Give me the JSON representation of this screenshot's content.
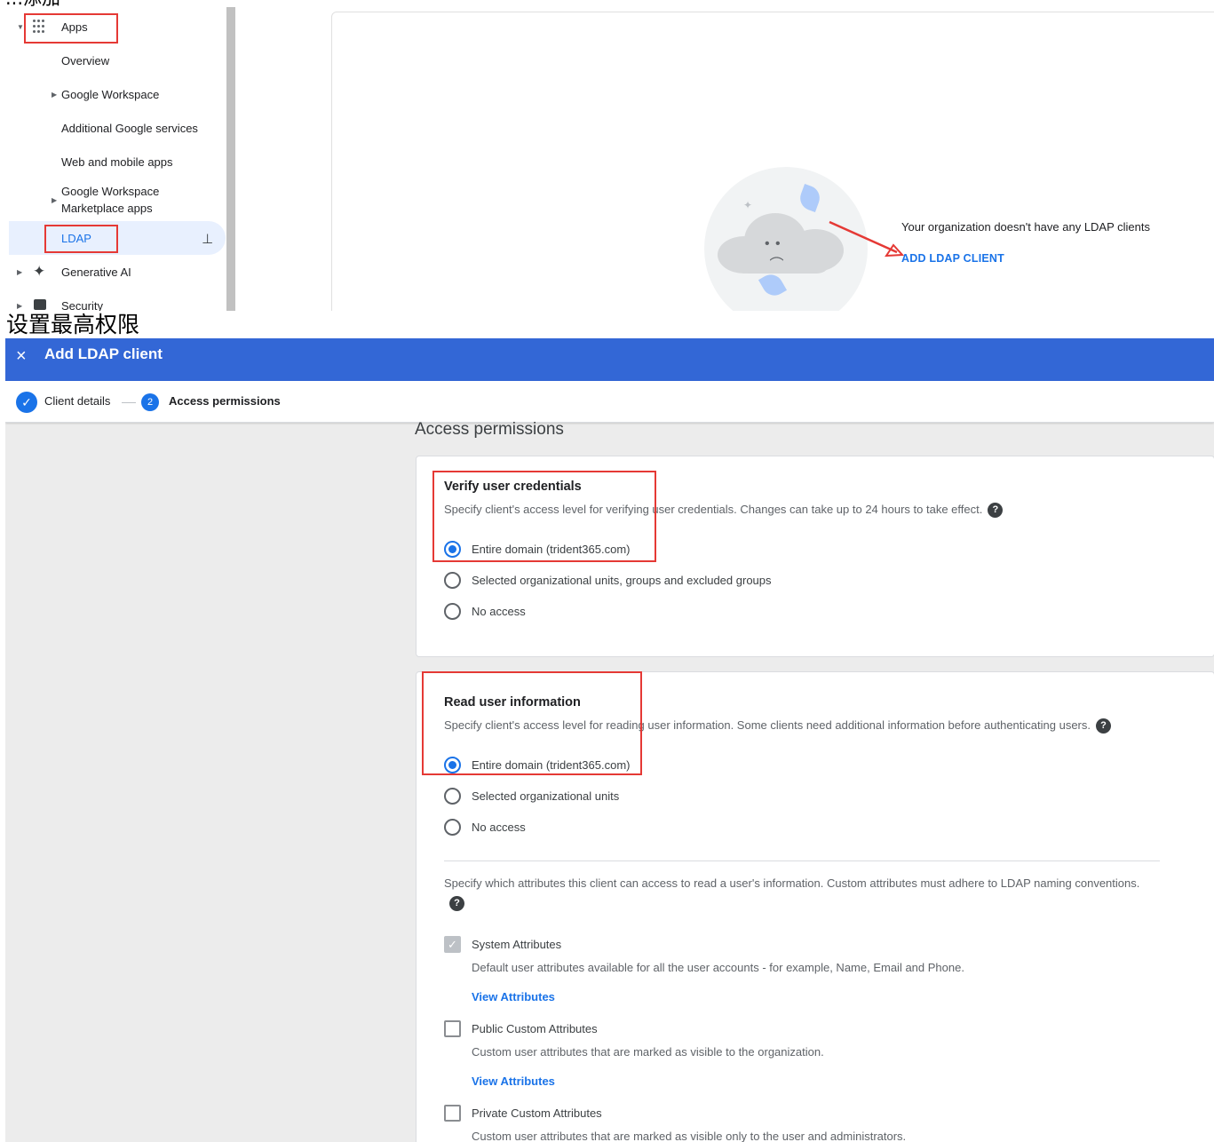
{
  "top_heading_fragment": "...添加",
  "sidebar": {
    "items": [
      {
        "label": "Apps"
      },
      {
        "label": "Overview"
      },
      {
        "label": "Google Workspace"
      },
      {
        "label": "Additional Google services"
      },
      {
        "label": "Web and mobile apps"
      },
      {
        "label": "Google Workspace Marketplace apps"
      },
      {
        "label": "LDAP"
      },
      {
        "label": "Generative AI"
      },
      {
        "label": "Security"
      }
    ]
  },
  "empty_state": {
    "message": "Your organization doesn't have any LDAP clients",
    "action": "ADD LDAP CLIENT"
  },
  "caption": "设置最高权限",
  "dialog": {
    "title": "Add LDAP client",
    "close_icon": "×",
    "steps": [
      {
        "label": "Client details",
        "state": "done",
        "icon": "✓"
      },
      {
        "label": "Access permissions",
        "state": "current",
        "number": "2"
      }
    ],
    "section_title": "Access permissions",
    "verify": {
      "heading": "Verify user credentials",
      "description": "Specify client's access level for verifying user credentials. Changes can take up to 24 hours to take effect.",
      "options": [
        {
          "label": "Entire domain (trident365.com)",
          "selected": true
        },
        {
          "label": "Selected organizational units, groups and excluded groups",
          "selected": false
        },
        {
          "label": "No access",
          "selected": false
        }
      ]
    },
    "read": {
      "heading": "Read user information",
      "description": "Specify client's access level for reading user information. Some clients need additional information before authenticating users.",
      "options": [
        {
          "label": "Entire domain (trident365.com)",
          "selected": true
        },
        {
          "label": "Selected organizational units",
          "selected": false
        },
        {
          "label": "No access",
          "selected": false
        }
      ],
      "attributes_intro": "Specify which attributes this client can access to read a user's information. Custom attributes must adhere to LDAP naming conventions.",
      "attributes": [
        {
          "label": "System Attributes",
          "checked": true,
          "disabled": true,
          "description": "Default user attributes available for all the user accounts - for example, Name, Email and Phone.",
          "link": "View Attributes"
        },
        {
          "label": "Public Custom Attributes",
          "checked": false,
          "description": "Custom user attributes that are marked as visible to the organization.",
          "link": "View Attributes"
        },
        {
          "label": "Private Custom Attributes",
          "checked": false,
          "description": "Custom user attributes that are marked as visible only to the user and administrators."
        }
      ]
    }
  },
  "colors": {
    "appbar": "#3367d6",
    "accent": "#1a73e8",
    "annotation_red": "#e53935"
  }
}
